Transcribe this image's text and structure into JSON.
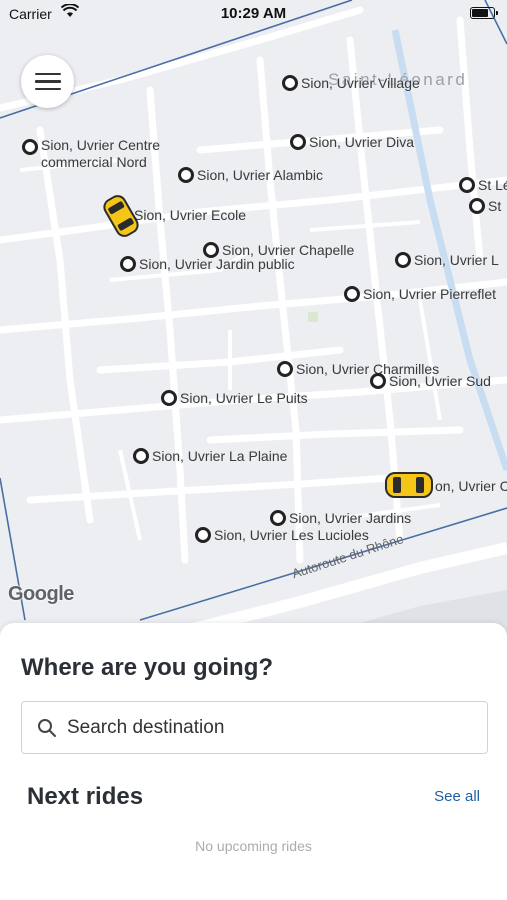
{
  "status": {
    "carrier": "Carrier",
    "time": "10:29 AM",
    "battery_level": 0.8
  },
  "map": {
    "place_label": "Saint-Léonard",
    "road_label": "Autoroute du Rhône",
    "attribution": "Google",
    "stops": [
      "Sion, Uvrier Village",
      "Sion, Uvrier Centre\ncommercial Nord",
      "Sion, Uvrier Diva",
      "Sion, Uvrier Alambic",
      "St Lé",
      "St",
      "Sion, Uvrier Ecole",
      "Sion, Uvrier Chapelle",
      "Sion, Uvrier Jardin public",
      "Sion, Uvrier L",
      "Sion, Uvrier Pierreflet",
      "Sion, Uvrier Charmilles",
      "Sion, Uvrier Sud",
      "Sion, Uvrier Le Puits",
      "Sion, Uvrier La Plaine",
      "on, Uvrier C",
      "Sion, Uvrier Jardins",
      "Sion, Uvrier Les Lucioles"
    ],
    "car_color": "#f5c518"
  },
  "sheet": {
    "title": "Where are you going?",
    "search_placeholder": "Search destination",
    "next_rides_title": "Next rides",
    "see_all": "See all",
    "empty_message": "No upcoming rides"
  },
  "colors": {
    "accent_link": "#1f5f9e",
    "zone_border": "#4a6fa5"
  }
}
